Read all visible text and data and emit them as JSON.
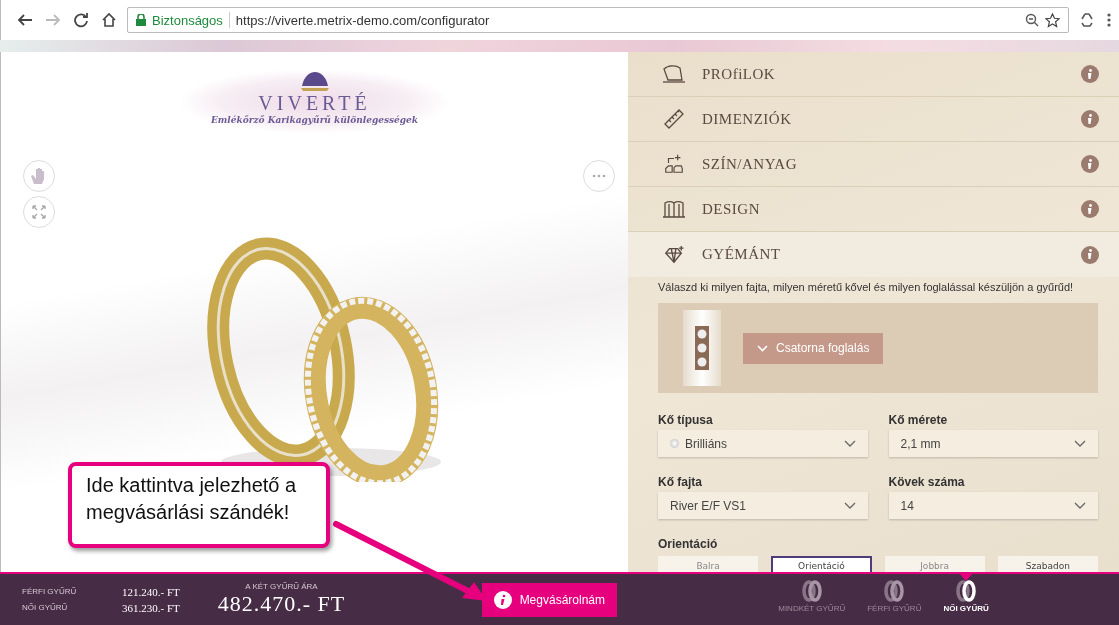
{
  "browser": {
    "secure_label": "Biztonságos",
    "url": "https://viverte.metrix-demo.com/configurator"
  },
  "logo": {
    "name": "VIVERTÉ",
    "tagline": "Emlékőrző Karikagyűrű különlegességek"
  },
  "sections": [
    {
      "title": "PROfiLOK",
      "kind": "profile",
      "expanded": false
    },
    {
      "title": "DIMENZIÓK",
      "kind": "ruler",
      "expanded": false
    },
    {
      "title": "SZÍN/ANYAG",
      "kind": "material",
      "expanded": false
    },
    {
      "title": "DESIGN",
      "kind": "design",
      "expanded": false
    },
    {
      "title": "GYÉMÁNT",
      "kind": "diamond",
      "expanded": true
    }
  ],
  "diamond": {
    "description": "Válaszd ki milyen fajta, milyen méretű kővel és milyen foglalással készüljön a gyűrűd!",
    "setting_button": "Csatorna foglalás",
    "fields": [
      {
        "label": "Kő típusa",
        "value": "Brilliáns",
        "kind": "stone"
      },
      {
        "label": "Kő mérete",
        "value": "2,1 mm",
        "kind": "plain"
      },
      {
        "label": "Kő fajta",
        "value": "River E/F VS1",
        "kind": "plain"
      },
      {
        "label": "Kövek száma",
        "value": "14",
        "kind": "plain"
      }
    ],
    "orientation_label": "Orientáció",
    "orientation_options": [
      {
        "label": "Balra",
        "selected": false,
        "disabled": true
      },
      {
        "label": "Orientáció",
        "selected": true,
        "disabled": false
      },
      {
        "label": "Jobbra",
        "selected": false,
        "disabled": true
      },
      {
        "label": "Szabadon",
        "selected": false,
        "disabled": false
      }
    ]
  },
  "prices": [
    {
      "label": "FÉRFI GYŰRŰ",
      "value": "121.240.- FT"
    },
    {
      "label": "NŐI GYŰRŰ",
      "value": "361.230.- FT"
    }
  ],
  "total": {
    "label": "A KÉT GYŰRŰ ÁRA",
    "value": "482.470.- FT"
  },
  "buy_button": "Megvásárolnám",
  "ring_toggles": [
    {
      "label": "MINDKÉT GYŰRŰ",
      "selected": false
    },
    {
      "label": "FÉRFI GYŰRŰ",
      "selected": false
    },
    {
      "label": "NŐI GYŰRŰ",
      "selected": true
    }
  ],
  "callout": "Ide kattintva jelezhető a megvásárlási szándék!"
}
